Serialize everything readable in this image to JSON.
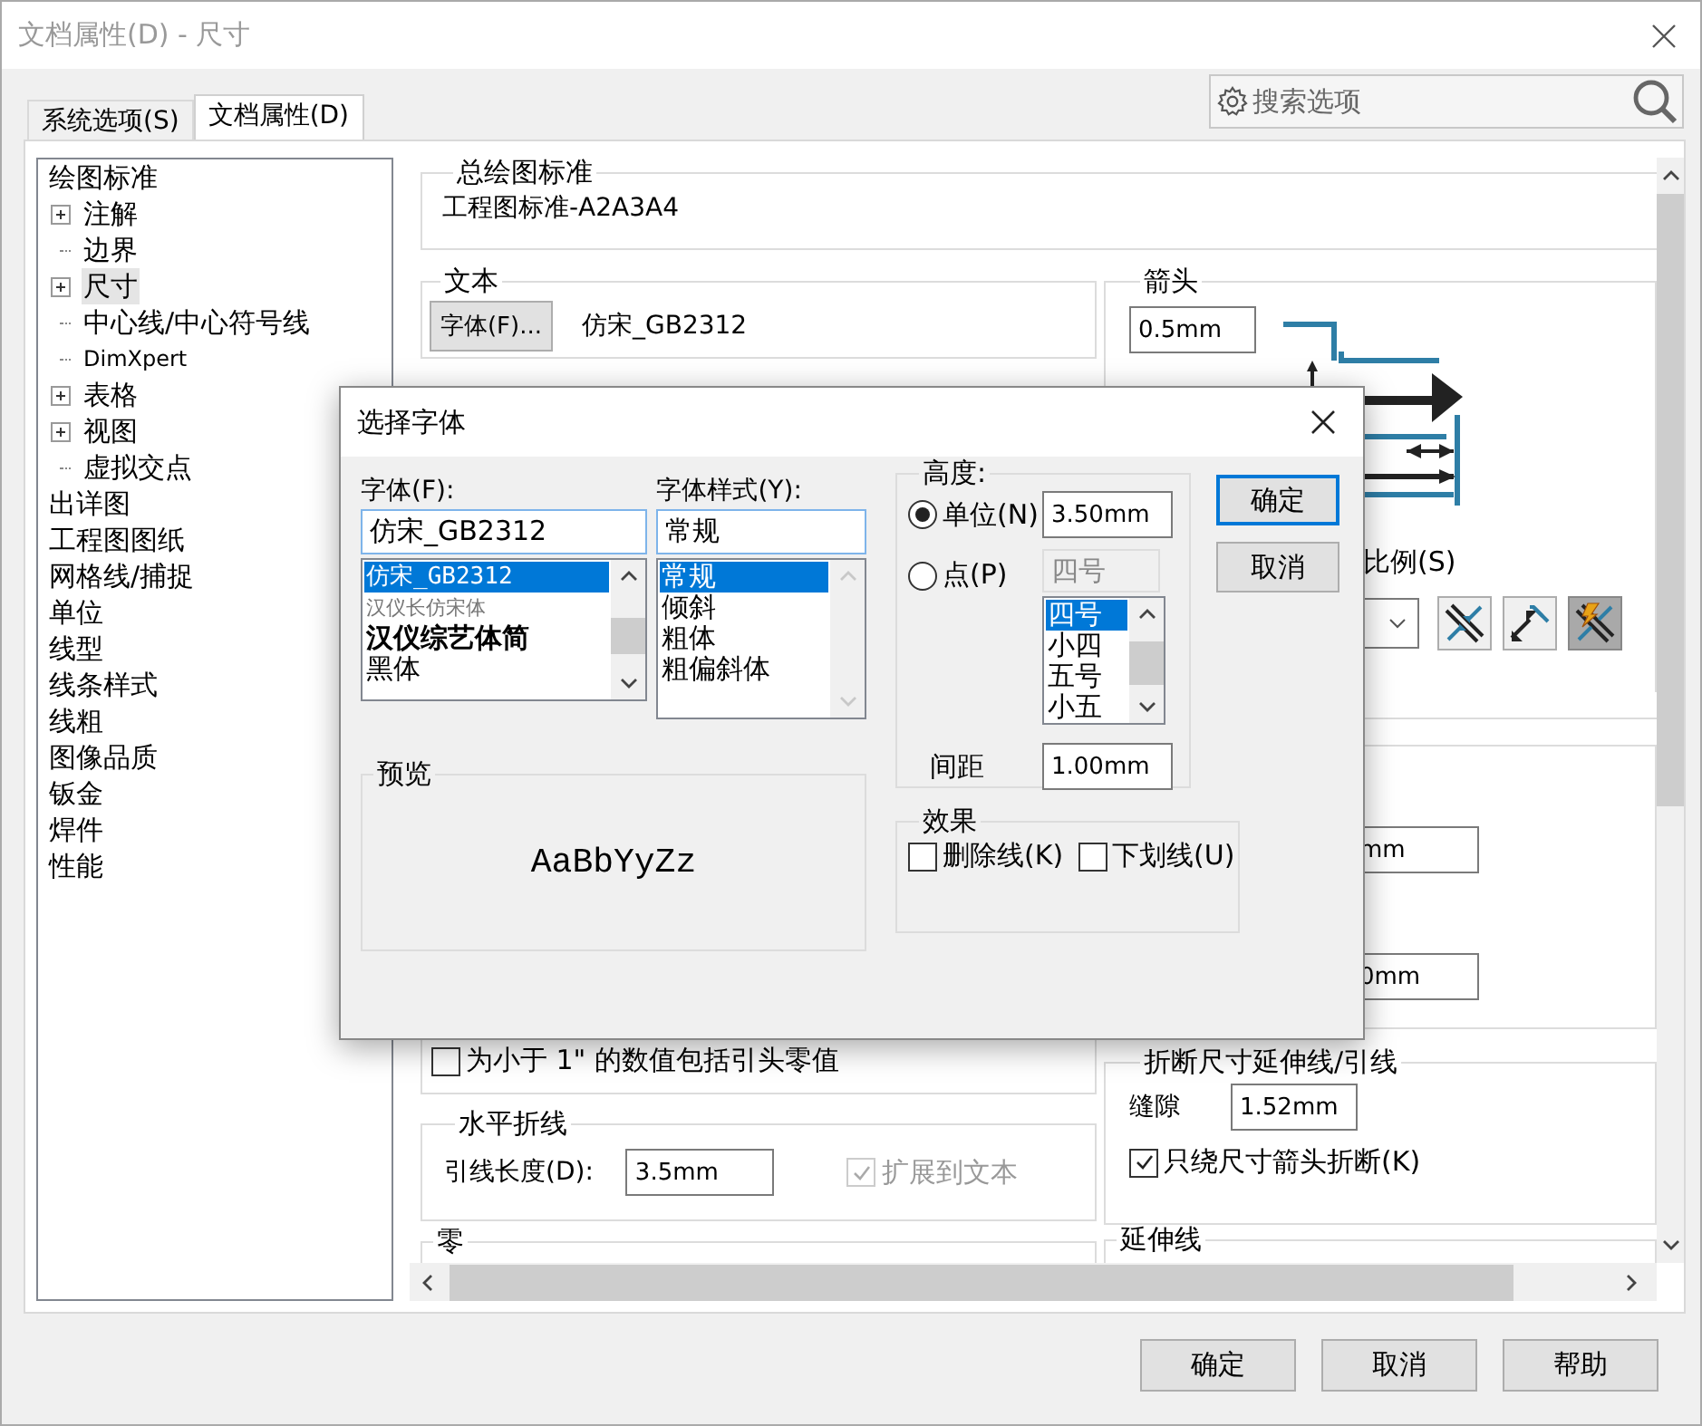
{
  "window": {
    "title": "文档属性(D) - 尺寸"
  },
  "tabs": [
    {
      "label": "系统选项(S)",
      "selected": false
    },
    {
      "label": "文档属性(D)",
      "selected": true
    }
  ],
  "search": {
    "placeholder": "搜索选项"
  },
  "tree": [
    {
      "label": "绘图标准",
      "selected": false,
      "children": [
        {
          "label": "注解",
          "selected": false,
          "collapsed": true
        },
        {
          "label": "边界",
          "selected": false,
          "collapsed": false
        },
        {
          "label": "尺寸",
          "selected": true,
          "collapsed": true
        },
        {
          "label": "中心线/中心符号线",
          "selected": false,
          "collapsed": false
        },
        {
          "label": "DimXpert",
          "selected": false,
          "collapsed": false
        },
        {
          "label": "表格",
          "selected": false,
          "collapsed": true
        },
        {
          "label": "视图",
          "selected": false,
          "collapsed": true
        },
        {
          "label": "虚拟交点",
          "selected": false,
          "collapsed": false
        }
      ]
    },
    {
      "label": "出详图",
      "selected": false
    },
    {
      "label": "工程图图纸",
      "selected": false
    },
    {
      "label": "网格线/捕捉",
      "selected": false
    },
    {
      "label": "单位",
      "selected": false
    },
    {
      "label": "线型",
      "selected": false
    },
    {
      "label": "线条样式",
      "selected": false
    },
    {
      "label": "线粗",
      "selected": false
    },
    {
      "label": "图像品质",
      "selected": false
    },
    {
      "label": "钣金",
      "selected": false
    },
    {
      "label": "焊件",
      "selected": false
    },
    {
      "label": "性能",
      "selected": false
    }
  ],
  "panel": {
    "drawing_standard": {
      "title": "总绘图标准",
      "value": "工程图标准-A2A3A4"
    },
    "text": {
      "title": "文本",
      "button": "字体(F)...",
      "font": "仿宋_GB2312"
    },
    "arrows": {
      "title": "箭头",
      "size": "0.5mm"
    },
    "scale_label": "比例(S)",
    "arrow_buttons": [
      {
        "kind": "inside",
        "selected": false
      },
      {
        "kind": "outside",
        "selected": false
      },
      {
        "kind": "smart",
        "selected": true
      }
    ],
    "fields": [
      "mm",
      "0mm"
    ],
    "leading_zero": {
      "label": "为小于 1\" 的数值包括引头零值",
      "checked": false
    },
    "horizontal_dogleg": {
      "title": "水平折线",
      "label": "引线长度(D):",
      "value": "3.5mm",
      "extend": {
        "label": "扩展到文本",
        "checked": true,
        "disabled": true
      }
    },
    "zero": {
      "title": "零"
    },
    "break_lines": {
      "title": "折断尺寸延伸线/引线",
      "gap_label": "缝隙",
      "gap": "1.52mm",
      "check": {
        "label": "只绕尺寸箭头折断(K)",
        "checked": true
      }
    },
    "extension_lines": {
      "title": "延伸线"
    }
  },
  "font_dialog": {
    "title": "选择字体",
    "font": {
      "label": "字体(F):",
      "value": "仿宋_GB2312",
      "items": [
        {
          "label": "仿宋_GB2312",
          "kind": "script",
          "selected": true
        },
        {
          "label": "汉仪长仿宋体",
          "kind": "light",
          "selected": false
        },
        {
          "label": "汉仪综艺体简",
          "kind": "bold",
          "selected": false
        },
        {
          "label": "黑体",
          "kind": "plain",
          "selected": false
        }
      ]
    },
    "style": {
      "label": "字体样式(Y):",
      "value": "常规",
      "items": [
        {
          "label": "常规",
          "selected": true
        },
        {
          "label": "倾斜",
          "selected": false
        },
        {
          "label": "粗体",
          "selected": false
        },
        {
          "label": "粗偏斜体",
          "selected": false
        }
      ]
    },
    "height": {
      "title": "高度:",
      "units": {
        "label": "单位(N)",
        "selected": true,
        "value": "3.50mm"
      },
      "points": {
        "label": "点(P)",
        "selected": false,
        "value": "四号",
        "items": [
          {
            "label": "四号",
            "selected": true
          },
          {
            "label": "小四",
            "selected": false
          },
          {
            "label": "五号",
            "selected": false
          },
          {
            "label": "小五",
            "selected": false
          }
        ]
      },
      "spacing_label": "间距",
      "spacing": "1.00mm"
    },
    "buttons": [
      {
        "label": "确定",
        "default": true
      },
      {
        "label": "取消",
        "default": false
      }
    ],
    "preview": {
      "title": "预览",
      "sample": "AaBbYyZz"
    },
    "effects": {
      "title": "效果",
      "items": [
        {
          "label": "删除线(K)",
          "checked": false
        },
        {
          "label": "下划线(U)",
          "checked": false
        }
      ]
    }
  },
  "buttons": [
    "确定",
    "取消",
    "帮助"
  ]
}
